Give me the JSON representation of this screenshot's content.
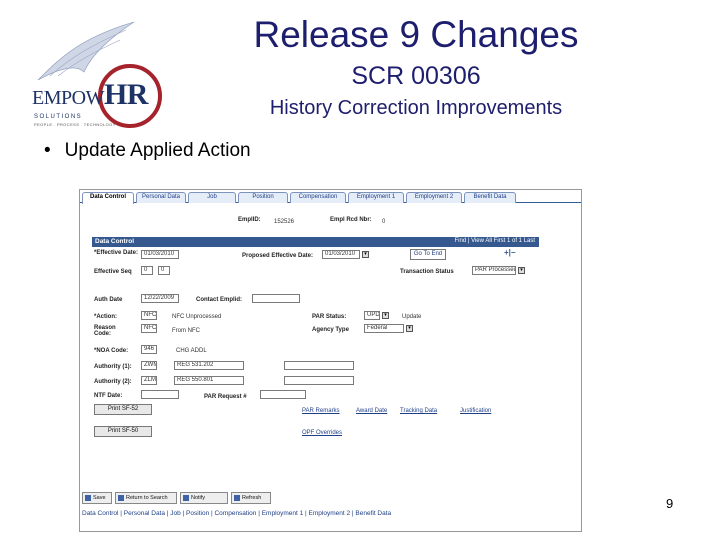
{
  "slide": {
    "title": "Release 9 Changes",
    "subtitle": "SCR 00306",
    "heading": "History Correction Improvements",
    "bullet": "Update Applied Action",
    "page_number": "9"
  },
  "logo": {
    "text_main": "EMPOW",
    "text_hr": "HR",
    "text_sub": "SOLUTIONS",
    "tagline": "PEOPLE . PROCESS . TECHNOLOGY"
  },
  "screenshot": {
    "tabs": [
      "Data Control",
      "Personal Data",
      "Job",
      "Position",
      "Compensation",
      "Employment 1",
      "Employment 2",
      "Benefit Data"
    ],
    "header": {
      "emplid_label": "EmplID:",
      "emplid_value": "152526",
      "empl_rcd_label": "Empl Rcd Nbr:",
      "empl_rcd_value": "0"
    },
    "section": {
      "title": "Data Control",
      "nav": "Find | View All    First  1 of 1  Last"
    },
    "fields": {
      "effective_date_label": "*Effective Date:",
      "effective_date_value": "01/03/2010",
      "proposed_eff_label": "Proposed Effective Date:",
      "proposed_eff_value": "01/03/2010",
      "go_to_end": "Go To End",
      "eff_seq_label": "Effective Seq",
      "eff_seq_value": "0",
      "eff_seq_value2": "0",
      "transaction_status_label": "Transaction Status",
      "transaction_status_value": "PAR Processed",
      "auth_date_label": "Auth Date",
      "auth_date_value": "12/22/2009",
      "contact_emplid_label": "Contact Emplid:",
      "action_label": "*Action:",
      "action_value": "NFC",
      "action_desc": "NFC Unprocessed",
      "par_status_label": "PAR Status:",
      "par_status_value": "UPD",
      "par_status_desc": "Update",
      "reason_label": "Reason Code:",
      "reason_value": "NFC",
      "reason_desc": "From NFC",
      "agency_type_label": "Agency Type",
      "agency_type_value": "Federal",
      "noa_label": "*NOA Code:",
      "noa_value": "946",
      "noa_desc": "CHG ADDL",
      "authority1_label": "Authority (1):",
      "authority1_value": "ZWM",
      "authority1_desc": "REG 531.202",
      "authority2_label": "Authority (2):",
      "authority2_value": "ZLM",
      "authority2_desc": "REG 550.801",
      "ntf_date_label": "NTF Date:",
      "par_request_label": "PAR Request #",
      "print_sf52": "Print SF-52",
      "print_sf50": "Print SF-50",
      "par_remarks": "PAR Remarks",
      "award_date": "Award Date",
      "tracking_data": "Tracking Data",
      "justification": "Justification",
      "opf_overrides": "OPF Overrides"
    },
    "toolbar": {
      "save": "Save",
      "return": "Return to Search",
      "notify": "Notify",
      "refresh": "Refresh"
    },
    "footer_links": "Data Control | Personal Data | Job | Position | Compensation | Employment 1 | Employment 2 | Benefit Data"
  },
  "colors": {
    "title": "#1e1e6e",
    "section_bar": "#35588f",
    "logo_ring": "#a6232b"
  }
}
